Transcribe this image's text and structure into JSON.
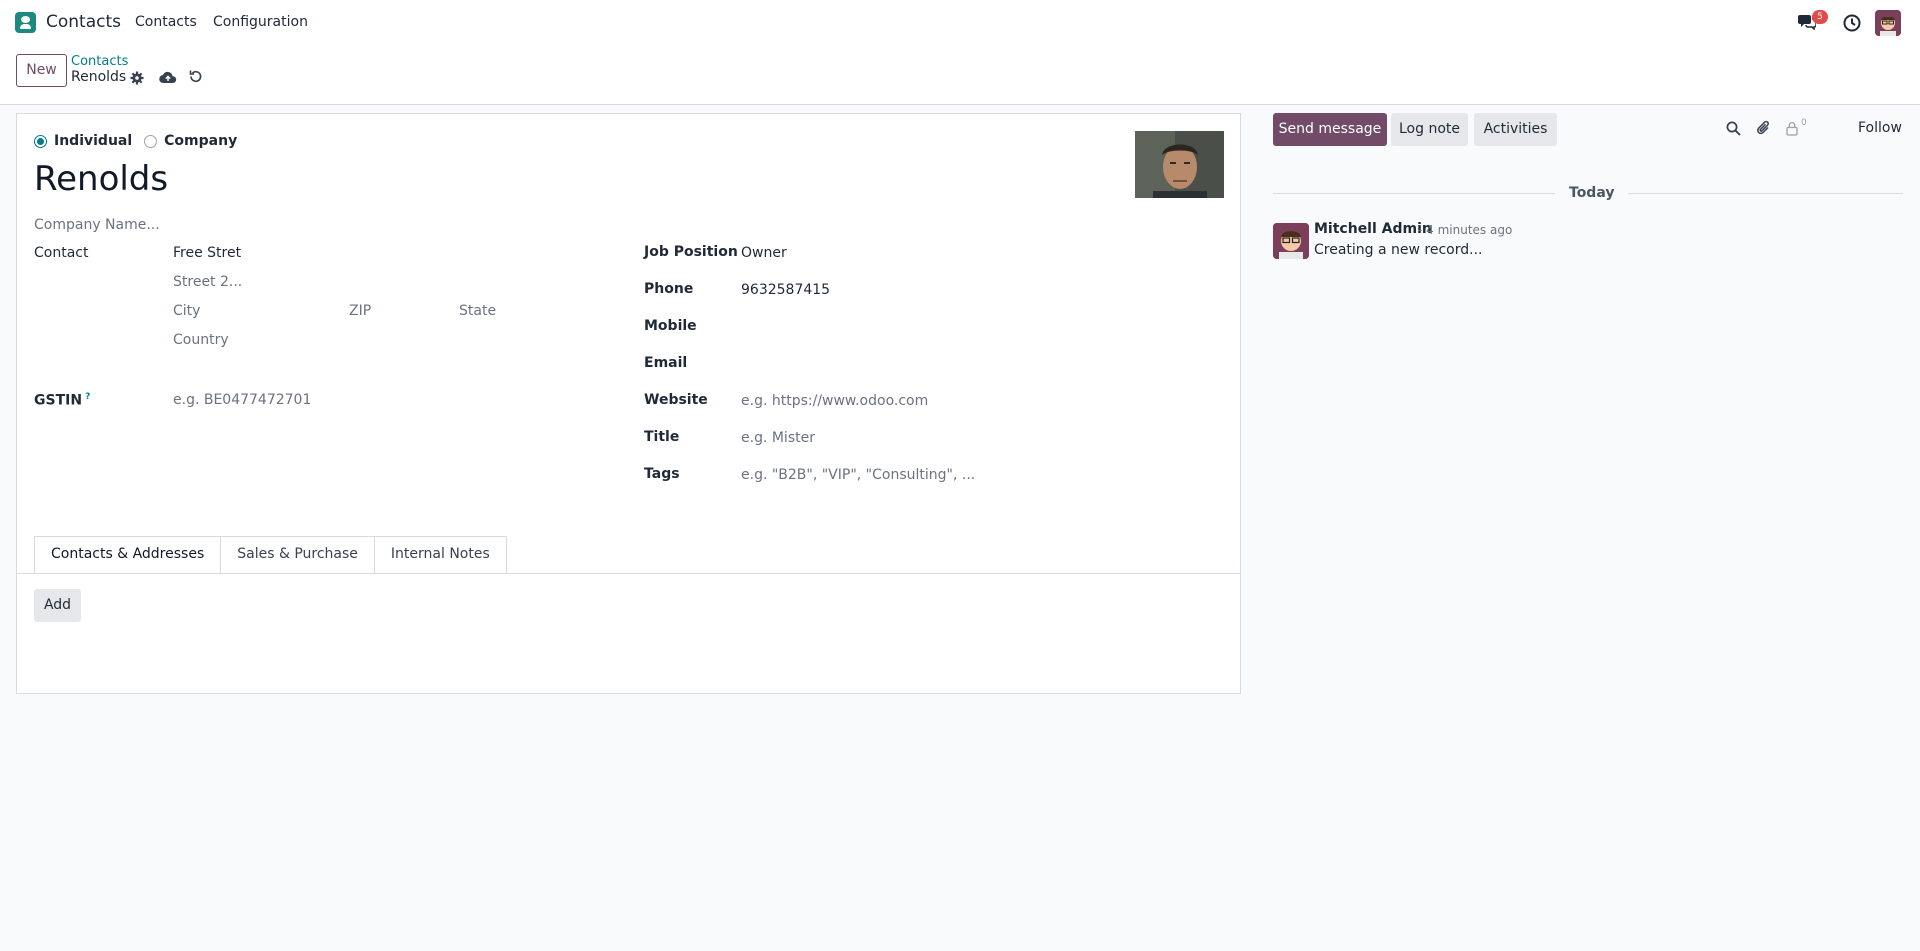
{
  "navbar": {
    "app_name": "Contacts",
    "menu": [
      "Contacts",
      "Configuration"
    ],
    "message_badge": "5"
  },
  "control": {
    "new_label": "New",
    "breadcrumb_parent": "Contacts",
    "breadcrumb_current": "Renolds"
  },
  "form": {
    "type_options": [
      "Individual",
      "Company"
    ],
    "type_selected": "Individual",
    "name": "Renolds",
    "company_name_placeholder": "Company Name...",
    "left": {
      "contact_label": "Contact",
      "street": "Free Stret",
      "street2_placeholder": "Street 2...",
      "city_placeholder": "City",
      "zip_placeholder": "ZIP",
      "state_placeholder": "State",
      "country_placeholder": "Country",
      "gstin_label": "GSTIN",
      "gstin_help": "?",
      "gstin_placeholder": "e.g. BE0477472701"
    },
    "right": {
      "job_position_label": "Job Position",
      "job_position_value": "Owner",
      "phone_label": "Phone",
      "phone_value": "9632587415",
      "mobile_label": "Mobile",
      "email_label": "Email",
      "website_label": "Website",
      "website_placeholder": "e.g. https://www.odoo.com",
      "title_label": "Title",
      "title_placeholder": "e.g. Mister",
      "tags_label": "Tags",
      "tags_placeholder": "e.g. \"B2B\", \"VIP\", \"Consulting\", ..."
    },
    "tabs": [
      "Contacts & Addresses",
      "Sales & Purchase",
      "Internal Notes"
    ],
    "active_tab": "Contacts & Addresses",
    "add_label": "Add"
  },
  "chatter": {
    "send_message": "Send message",
    "log_note": "Log note",
    "activities": "Activities",
    "follower_count": "0",
    "follow": "Follow",
    "date_separator": "Today",
    "messages": [
      {
        "author": "Mitchell Admin",
        "time": "- 4 minutes ago",
        "body": "Creating a new record..."
      }
    ]
  },
  "colors": {
    "primary": "#714b67",
    "accent": "#017e84",
    "badge": "#e14b4b"
  }
}
